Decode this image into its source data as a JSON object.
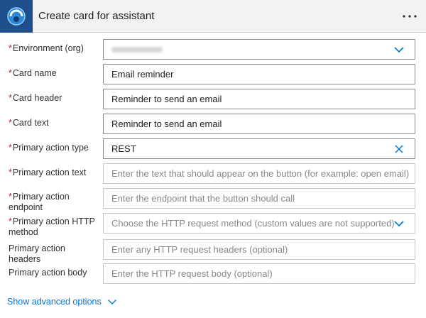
{
  "header": {
    "title": "Create card for assistant",
    "more_label": "···",
    "accent": "#1f4e8c"
  },
  "form": {
    "required_mark": "*",
    "fields": [
      {
        "label": "Environment (org)",
        "required": true,
        "type": "dropdown",
        "value": "",
        "placeholder": ""
      },
      {
        "label": "Card name",
        "required": true,
        "type": "text",
        "value": "Email reminder"
      },
      {
        "label": "Card header",
        "required": true,
        "type": "text",
        "value": "Reminder to send an email"
      },
      {
        "label": "Card text",
        "required": true,
        "type": "text",
        "value": "Reminder to send an email"
      },
      {
        "label": "Primary action type",
        "required": true,
        "type": "combo-clearable",
        "value": "REST"
      },
      {
        "label": "Primary action text",
        "required": true,
        "type": "text",
        "placeholder": "Enter the text that should appear on the button (for example: open email)"
      },
      {
        "label": "Primary action endpoint",
        "required": true,
        "type": "text",
        "placeholder": "Enter the endpoint that the button should call"
      },
      {
        "label": "Primary action HTTP method",
        "required": true,
        "type": "dropdown",
        "placeholder": "Choose the HTTP request method (custom values are not supported)"
      },
      {
        "label": "Primary action headers",
        "required": false,
        "type": "text",
        "placeholder": "Enter any HTTP request headers (optional)"
      },
      {
        "label": "Primary action body",
        "required": false,
        "type": "text",
        "placeholder": "Enter the HTTP request body (optional)"
      }
    ]
  },
  "footer": {
    "advanced_label": "Show advanced options"
  },
  "colors": {
    "link": "#0078d4",
    "required": "#a4262c",
    "chevron": "#0078d4"
  }
}
